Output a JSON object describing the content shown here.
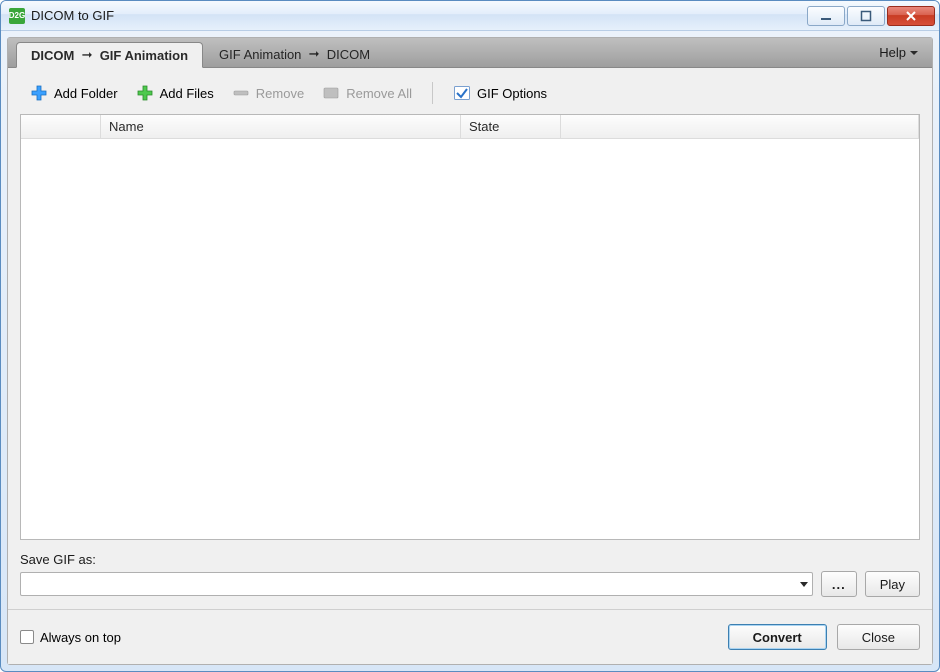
{
  "window": {
    "title": "DICOM to GIF",
    "app_icon_text": "D2G"
  },
  "tabs": {
    "tab1_left": "DICOM",
    "tab1_right": "GIF Animation",
    "tab2_left": "GIF Animation",
    "tab2_right": "DICOM"
  },
  "help": {
    "label": "Help"
  },
  "toolbar": {
    "add_folder": "Add Folder",
    "add_files": "Add Files",
    "remove": "Remove",
    "remove_all": "Remove All",
    "gif_options": "GIF Options"
  },
  "columns": {
    "name": "Name",
    "state": "State"
  },
  "save": {
    "label": "Save GIF as:",
    "value": "",
    "browse": "...",
    "play": "Play"
  },
  "footer": {
    "always_on_top": "Always on top",
    "convert": "Convert",
    "close": "Close"
  }
}
